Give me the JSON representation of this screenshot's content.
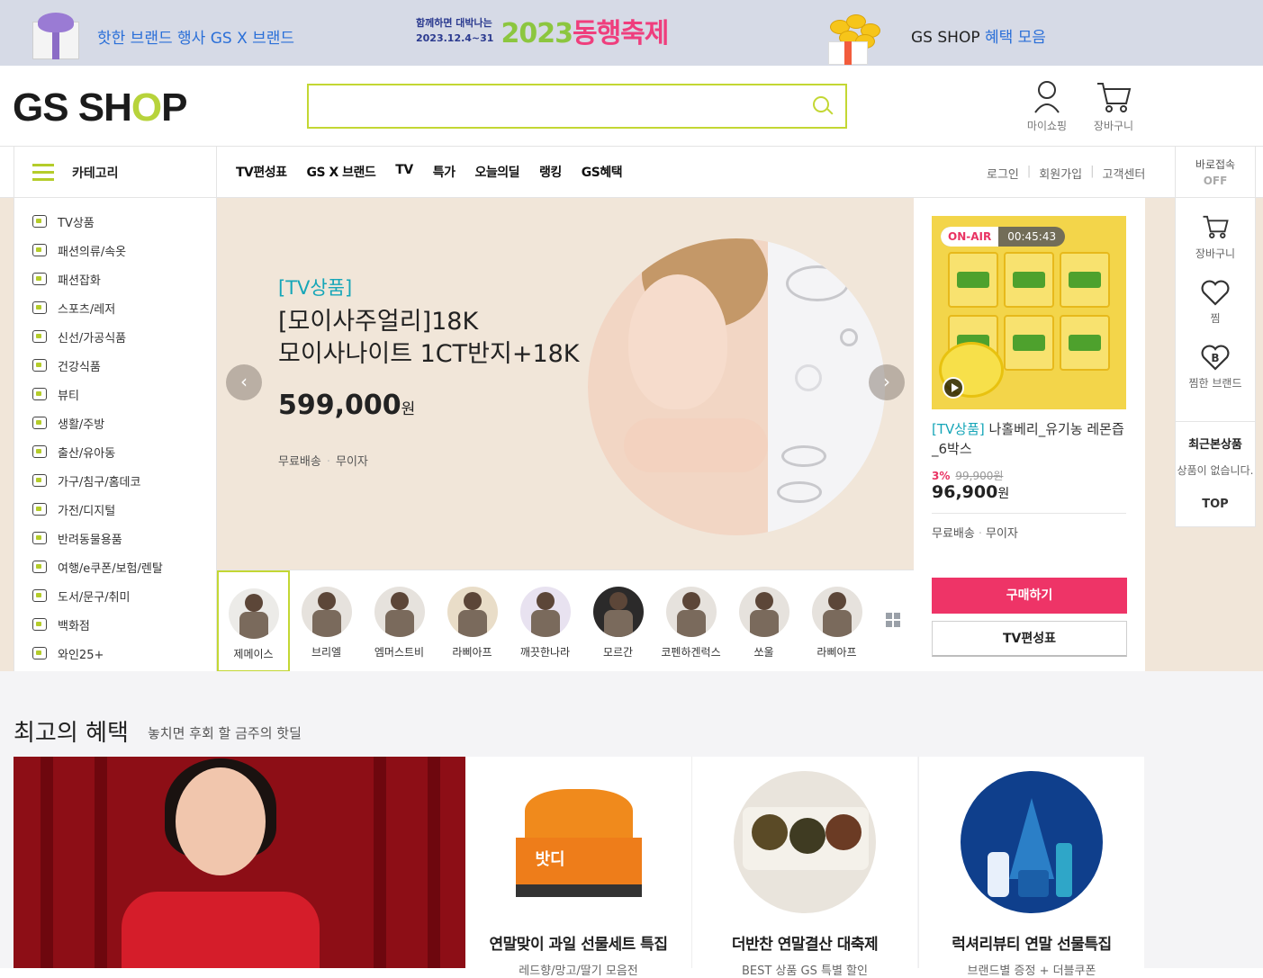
{
  "promo": {
    "left_text": "핫한 브랜드 행사",
    "left_highlight": "GS X 브랜드",
    "center_small_1": "함께하면 대박나는",
    "center_small_2": "2023.12.4~31",
    "center_big_num": "2023",
    "center_big_word": "동행축제",
    "right_text": "GS SHOP",
    "right_highlight": "혜택 모음"
  },
  "header": {
    "logo_left": "GS SH",
    "logo_o": "O",
    "logo_right": "P",
    "search_placeholder": "",
    "mypage_label": "마이쇼핑",
    "cart_label": "장바구니"
  },
  "nav": {
    "category_label": "카테고리",
    "menu": [
      "TV편성표",
      "GS X 브랜드",
      "TV",
      "특가",
      "오늘의딜",
      "랭킹",
      "GS혜택"
    ],
    "util": [
      "로그인",
      "회원가입",
      "고객센터"
    ],
    "direct_label": "바로접속",
    "direct_state": "OFF"
  },
  "sidebar": {
    "items": [
      "TV상품",
      "패션의류/속옷",
      "패션잡화",
      "스포츠/레저",
      "신선/가공식품",
      "건강식품",
      "뷰티",
      "생활/주방",
      "출산/유아동",
      "가구/침구/홈데코",
      "가전/디지털",
      "반려동물용품",
      "여행/e쿠폰/보험/렌탈",
      "도서/문구/취미",
      "백화점",
      "와인25+"
    ]
  },
  "hero": {
    "category": "[TV상품]",
    "title_line1": "[모이사주얼리]18K",
    "title_line2": "모이사나이트 1CT반지+18K",
    "price": "599,000",
    "price_unit": "원",
    "ship": "무료배송",
    "interest": "무이자",
    "prev": "‹",
    "next": "›"
  },
  "thumbs": [
    "제메이스",
    "브리엘",
    "엠머스트비",
    "라삐아프",
    "깨끗한나라",
    "모르간",
    "코펜하겐럭스",
    "쏘울",
    "라삐아프"
  ],
  "onair": {
    "badge": "ON-AIR",
    "time": "00:45:43",
    "category": "[TV상품]",
    "title": "나홀베리_유기농 레몬즙_6박스",
    "discount": "3%",
    "orig_price": "99,900원",
    "price": "96,900",
    "price_unit": "원",
    "ship": "무료배송",
    "interest": "무이자",
    "buy_label": "구매하기",
    "tv_label": "TV편성표"
  },
  "floating": {
    "cart": "장바구니",
    "wish": "찜",
    "wish_brand": "찜한 브랜드",
    "brand_badge": "B",
    "recent_title": "최근본상품",
    "recent_empty": "상품이 없습니다.",
    "top": "TOP"
  },
  "benefits": {
    "title": "최고의 혜택",
    "subtitle": "놓치면 후회 할 금주의 핫딜",
    "cards": [
      {
        "title": "연말맞이 과일 선물세트 특집",
        "sub": "레드향/망고/딸기 모음전",
        "label": "밧디"
      },
      {
        "title": "더반찬 연말결산 대축제",
        "sub": "BEST 상품 GS 특별 할인"
      },
      {
        "title": "럭셔리뷰티 연말 선물특집",
        "sub": "브랜드별 증정 + 더블쿠폰"
      }
    ]
  }
}
